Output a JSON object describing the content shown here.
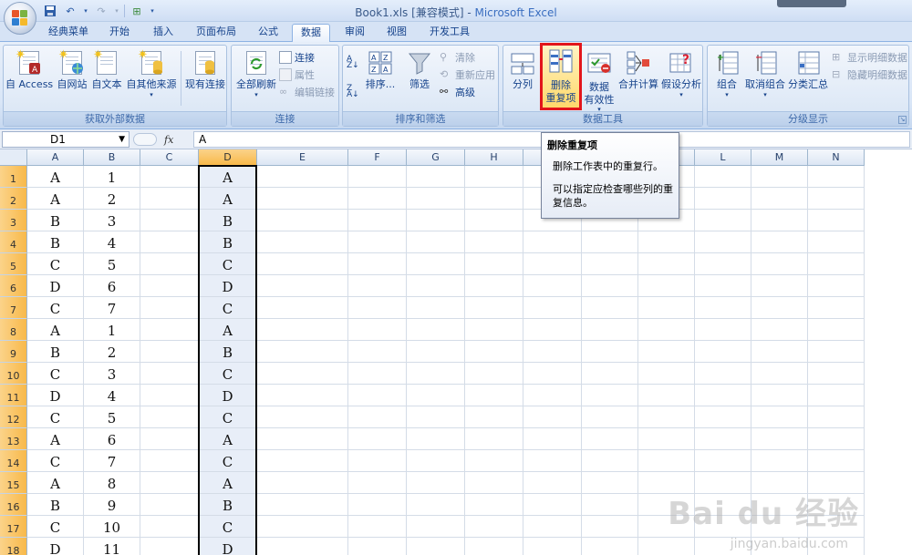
{
  "window": {
    "title_file": "Book1.xls",
    "title_mode": "[兼容模式]",
    "title_sep": " - ",
    "title_app": "Microsoft Excel"
  },
  "tabs": [
    {
      "label": "经典菜单",
      "active": false
    },
    {
      "label": "开始",
      "active": false
    },
    {
      "label": "插入",
      "active": false
    },
    {
      "label": "页面布局",
      "active": false
    },
    {
      "label": "公式",
      "active": false
    },
    {
      "label": "数据",
      "active": true
    },
    {
      "label": "审阅",
      "active": false
    },
    {
      "label": "视图",
      "active": false
    },
    {
      "label": "开发工具",
      "active": false
    }
  ],
  "ribbon": {
    "get_external": {
      "label": "获取外部数据",
      "buttons": [
        "自 Access",
        "自网站",
        "自文本",
        "自其他来源",
        "现有连接"
      ]
    },
    "connections": {
      "label": "连接",
      "refresh_all": "全部刷新",
      "connections": "连接",
      "properties": "属性",
      "edit_links": "编辑链接"
    },
    "sort_filter": {
      "label": "排序和筛选",
      "sort": "排序...",
      "filter": "筛选",
      "clear": "清除",
      "reapply": "重新应用",
      "advanced": "高级"
    },
    "data_tools": {
      "label": "数据工具",
      "text_to_columns": "分列",
      "remove_duplicates_1": "删除",
      "remove_duplicates_2": "重复项",
      "validation_1": "数据",
      "validation_2": "有效性",
      "consolidate": "合并计算",
      "what_if": "假设分析"
    },
    "outline": {
      "label": "分级显示",
      "group": "组合",
      "ungroup": "取消组合",
      "subtotal": "分类汇总",
      "show_detail": "显示明细数据",
      "hide_detail": "隐藏明细数据"
    }
  },
  "formula_bar": {
    "name_box": "D1",
    "fx": "fx",
    "content": "A"
  },
  "columns": [
    "A",
    "B",
    "C",
    "D",
    "E",
    "F",
    "G",
    "H",
    "I",
    "J",
    "K",
    "L",
    "M",
    "N"
  ],
  "selected_column": "D",
  "rows": [
    {
      "num": "1",
      "A": "A",
      "B": "1",
      "D": "A"
    },
    {
      "num": "2",
      "A": "A",
      "B": "2",
      "D": "A"
    },
    {
      "num": "3",
      "A": "B",
      "B": "3",
      "D": "B"
    },
    {
      "num": "4",
      "A": "B",
      "B": "4",
      "D": "B"
    },
    {
      "num": "5",
      "A": "C",
      "B": "5",
      "D": "C"
    },
    {
      "num": "6",
      "A": "D",
      "B": "6",
      "D": "D"
    },
    {
      "num": "7",
      "A": "C",
      "B": "7",
      "D": "C"
    },
    {
      "num": "8",
      "A": "A",
      "B": "1",
      "D": "A"
    },
    {
      "num": "9",
      "A": "B",
      "B": "2",
      "D": "B"
    },
    {
      "num": "10",
      "A": "C",
      "B": "3",
      "D": "C"
    },
    {
      "num": "11",
      "A": "D",
      "B": "4",
      "D": "D"
    },
    {
      "num": "12",
      "A": "C",
      "B": "5",
      "D": "C"
    },
    {
      "num": "13",
      "A": "A",
      "B": "6",
      "D": "A"
    },
    {
      "num": "14",
      "A": "C",
      "B": "7",
      "D": "C"
    },
    {
      "num": "15",
      "A": "A",
      "B": "8",
      "D": "A"
    },
    {
      "num": "16",
      "A": "B",
      "B": "9",
      "D": "B"
    },
    {
      "num": "17",
      "A": "C",
      "B": "10",
      "D": "C"
    },
    {
      "num": "18",
      "A": "D",
      "B": "11",
      "D": "D"
    }
  ],
  "tooltip": {
    "title": "删除重复项",
    "line1": "删除工作表中的重复行。",
    "line2": "可以指定应检查哪些列的重",
    "line3": "复信息。"
  },
  "watermark": {
    "brand": "Bai du 经验",
    "url": "jingyan.baidu.com"
  },
  "colors": {
    "highlight_border": "#e2151b",
    "selected_header": "#f8b94a",
    "ribbon_text": "#15428b"
  }
}
